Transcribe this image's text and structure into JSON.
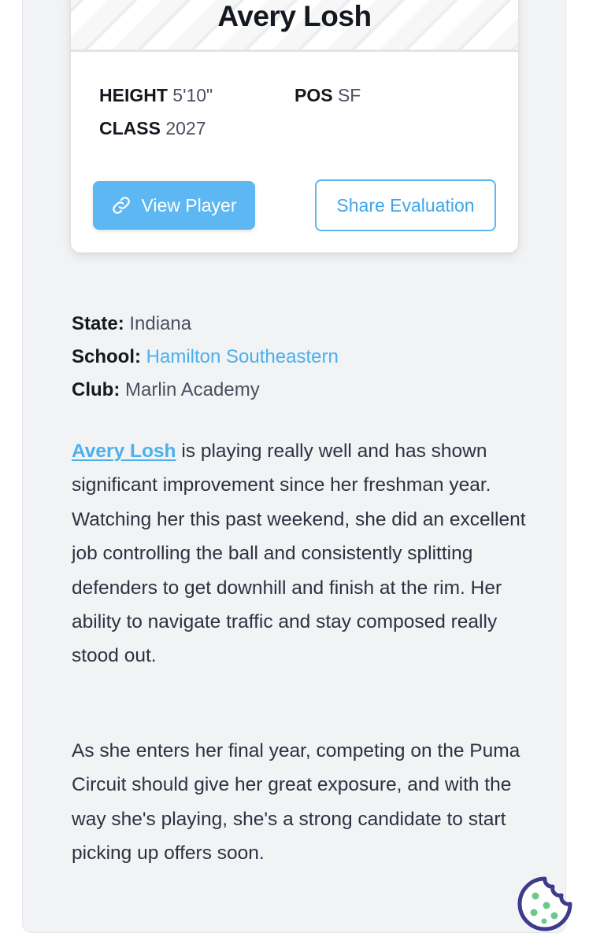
{
  "player": {
    "name": "Avery Losh",
    "height_label": "HEIGHT",
    "height_value": "5'10\"",
    "pos_label": "POS",
    "pos_value": "SF",
    "class_label": "CLASS",
    "class_value": "2027"
  },
  "buttons": {
    "view_player": "View Player",
    "share_evaluation": "Share Evaluation"
  },
  "info": {
    "state_label": "State:",
    "state_value": "Indiana",
    "school_label": "School:",
    "school_value": "Hamilton Southeastern",
    "club_label": "Club:",
    "club_value": "Marlin Academy"
  },
  "evaluation": {
    "paragraph1_link": "Avery Losh",
    "paragraph1_rest": " is playing really well and has shown significant improvement since her freshman year. Watching her this past weekend, she did an excellent job controlling the ball and consistently splitting defenders to get downhill and finish at the rim. Her ability to navigate traffic and stay composed really stood out.",
    "paragraph2": "As she enters her final year, competing on the Puma Circuit should give her great exposure, and with the way she's playing, she's a strong candidate to start picking up offers soon."
  },
  "icons": {
    "view_player_icon": "link-icon",
    "cookie_icon": "cookie-icon"
  },
  "colors": {
    "accent": "#5cb7f2",
    "link": "#4ab0ee",
    "cookie": "#3e3a8c",
    "cookie_dots": "#6cc98a"
  }
}
